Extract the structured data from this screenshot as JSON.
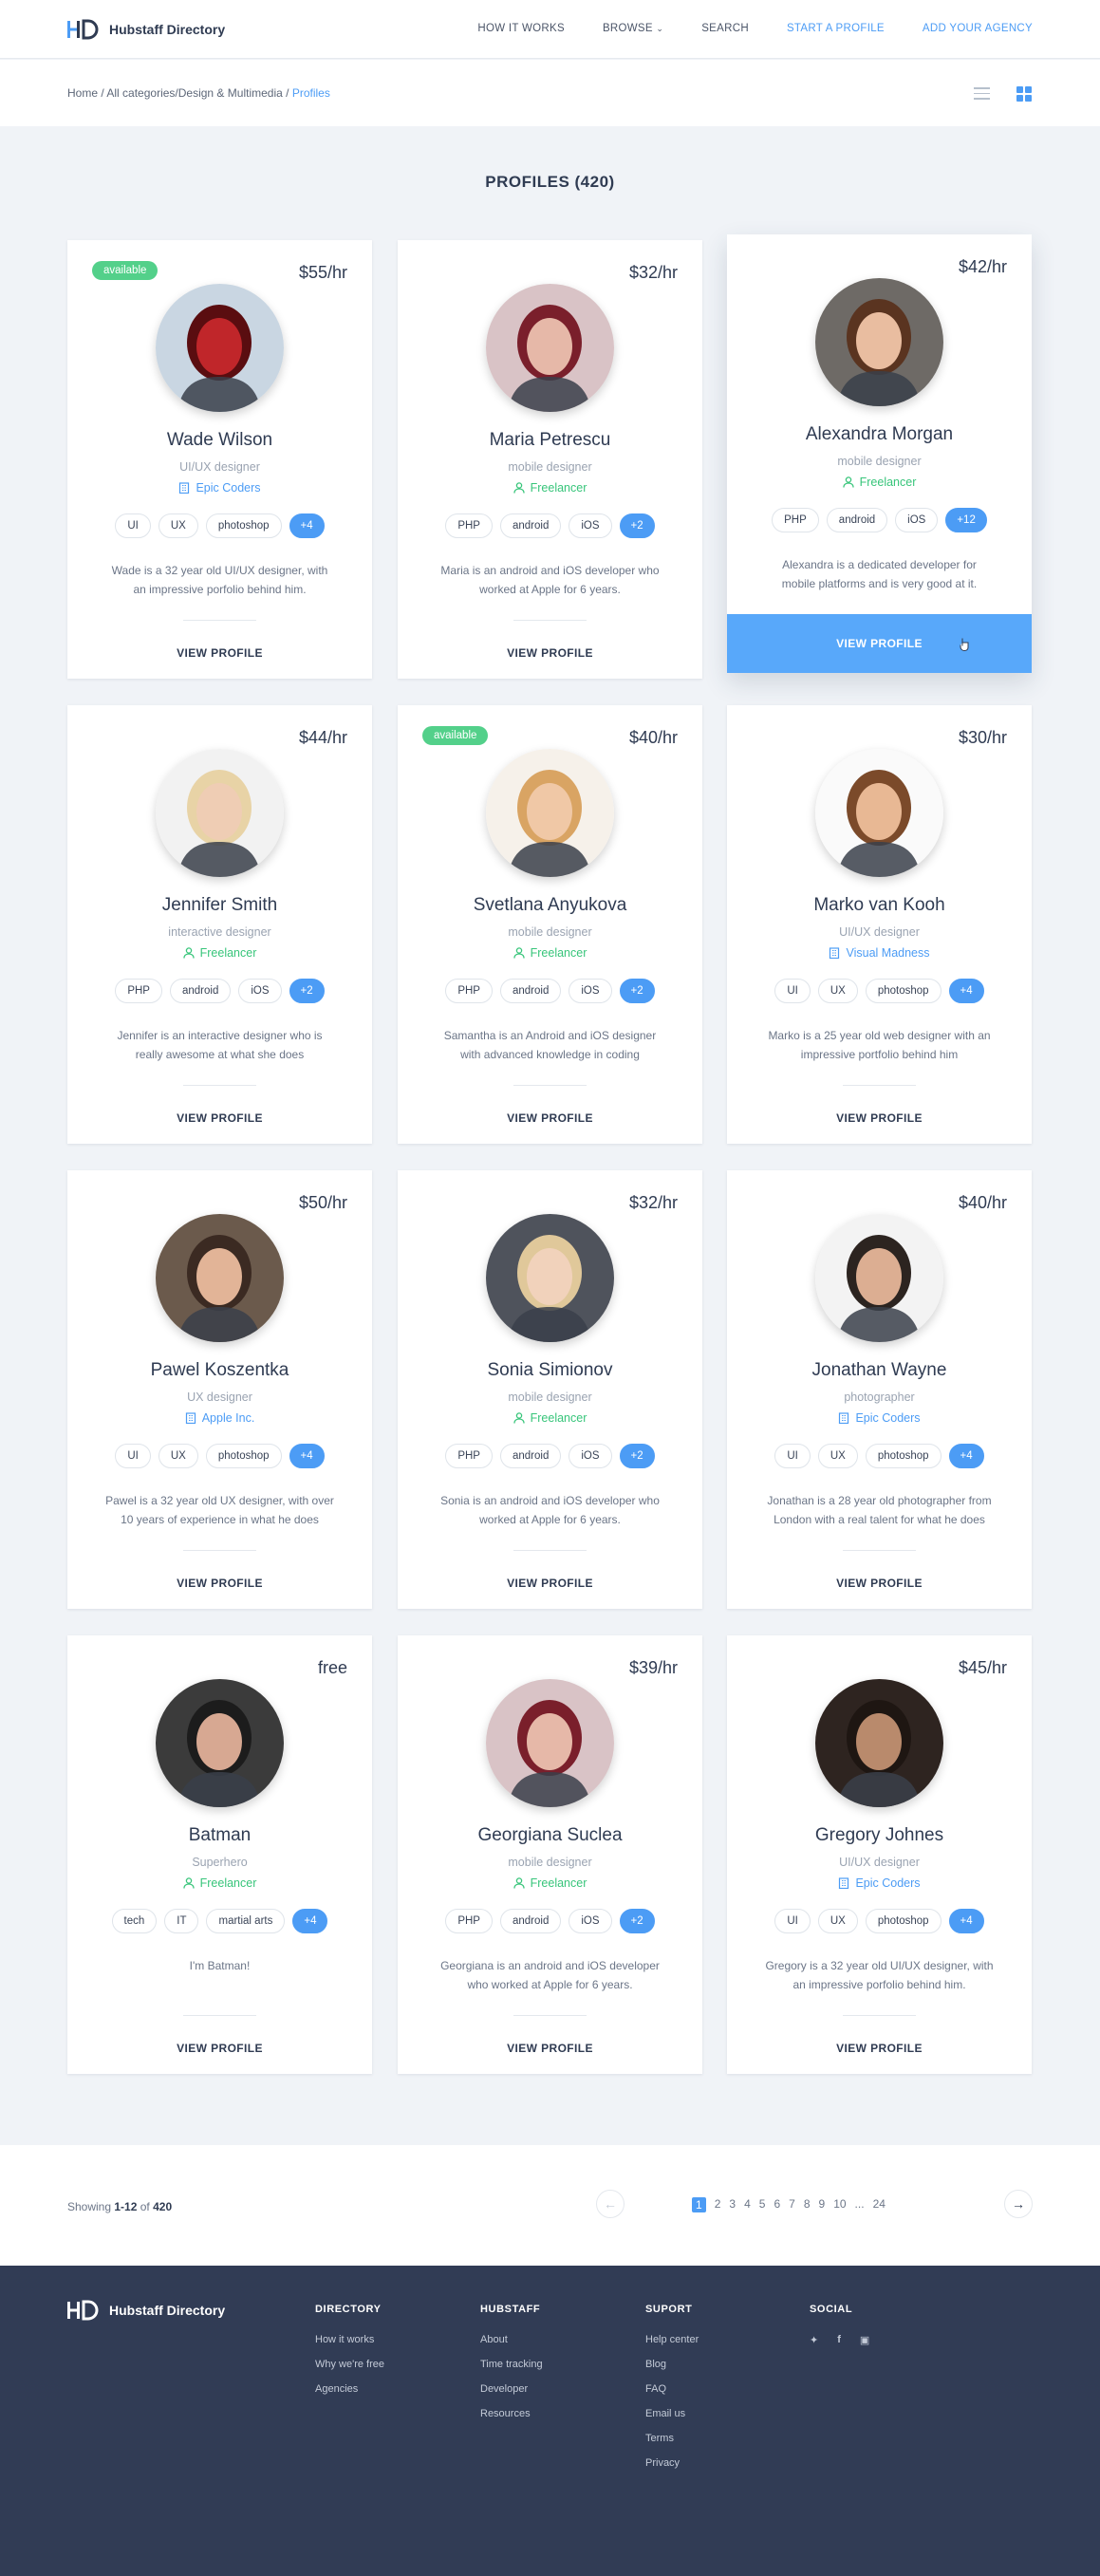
{
  "app": {
    "name": "Hubstaff Directory"
  },
  "nav": {
    "links": [
      "HOW IT WORKS",
      "BROWSE",
      "SEARCH"
    ],
    "cta": [
      "START A PROFILE",
      "ADD YOUR AGENCY"
    ]
  },
  "breadcrumb": {
    "home": "Home",
    "sep": "/",
    "middle": "All categories/Design & Multimedia",
    "current": "Profiles"
  },
  "page_title": "PROFILES (420)",
  "cards": [
    {
      "name": "Wade Wilson",
      "role": "UI/UX designer",
      "company": "Epic Coders",
      "company_type": "agency",
      "rate": "$55/hr",
      "badge": "available",
      "tags": [
        "UI",
        "UX",
        "photoshop"
      ],
      "more": "+4",
      "desc": "Wade is a 32 year old UI/UX designer, with an impressive porfolio behind him.",
      "action": "VIEW PROFILE"
    },
    {
      "name": "Maria Petrescu",
      "role": "mobile designer",
      "company": "Freelancer",
      "company_type": "freelancer",
      "rate": "$32/hr",
      "tags": [
        "PHP",
        "android",
        "iOS"
      ],
      "more": "+2",
      "desc": "Maria is an android and iOS developer who worked at Apple for 6 years.",
      "action": "VIEW PROFILE"
    },
    {
      "name": "Alexandra Morgan",
      "role": "mobile designer",
      "company": "Freelancer",
      "company_type": "freelancer",
      "rate": "$42/hr",
      "tags": [
        "PHP",
        "android",
        "iOS"
      ],
      "more": "+12",
      "desc": "Alexandra is a dedicated developer for mobile platforms and is very good at it.",
      "action": "VIEW PROFILE",
      "featured": true
    },
    {
      "name": "Jennifer Smith",
      "role": "interactive designer",
      "company": "Freelancer",
      "company_type": "freelancer",
      "rate": "$44/hr",
      "tags": [
        "PHP",
        "android",
        "iOS"
      ],
      "more": "+2",
      "desc": "Jennifer is an interactive designer who is really awesome at what she does",
      "action": "VIEW PROFILE"
    },
    {
      "name": "Svetlana Anyukova",
      "role": "mobile designer",
      "company": "Freelancer",
      "company_type": "freelancer",
      "rate": "$40/hr",
      "badge": "available",
      "tags": [
        "PHP",
        "android",
        "iOS"
      ],
      "more": "+2",
      "desc": "Samantha is an Android and iOS designer with advanced knowledge in coding",
      "action": "VIEW PROFILE"
    },
    {
      "name": "Marko van Kooh",
      "role": "UI/UX designer",
      "company": "Visual Madness",
      "company_type": "agency",
      "rate": "$30/hr",
      "tags": [
        "UI",
        "UX",
        "photoshop"
      ],
      "more": "+4",
      "desc": "Marko is a 25 year old  web designer with an impressive portfolio behind him",
      "action": "VIEW PROFILE"
    },
    {
      "name": "Pawel Koszentka",
      "role": "UX designer",
      "company": "Apple Inc.",
      "company_type": "agency",
      "rate": "$50/hr",
      "tags": [
        "UI",
        "UX",
        "photoshop"
      ],
      "more": "+4",
      "desc": "Pawel is a 32 year old UX designer, with over 10 years of experience in what he does",
      "action": "VIEW PROFILE"
    },
    {
      "name": "Sonia Simionov",
      "role": "mobile designer",
      "company": "Freelancer",
      "company_type": "freelancer",
      "rate": "$32/hr",
      "tags": [
        "PHP",
        "android",
        "iOS"
      ],
      "more": "+2",
      "desc": "Sonia is an android and iOS developer who worked at Apple for 6 years.",
      "action": "VIEW PROFILE"
    },
    {
      "name": "Jonathan Wayne",
      "role": "photographer",
      "company": "Epic Coders",
      "company_type": "agency",
      "rate": "$40/hr",
      "tags": [
        "UI",
        "UX",
        "photoshop"
      ],
      "more": "+4",
      "desc": "Jonathan is a 28 year old photographer from London with a real talent for what he does",
      "action": "VIEW PROFILE"
    },
    {
      "name": "Batman",
      "role": "Superhero",
      "company": "Freelancer",
      "company_type": "freelancer",
      "rate": "free",
      "tags": [
        "tech",
        "IT",
        "martial arts"
      ],
      "more": "+4",
      "desc": "I'm Batman!",
      "action": "VIEW PROFILE"
    },
    {
      "name": "Georgiana Suclea",
      "role": "mobile designer",
      "company": "Freelancer",
      "company_type": "freelancer",
      "rate": "$39/hr",
      "tags": [
        "PHP",
        "android",
        "iOS"
      ],
      "more": "+2",
      "desc": "Georgiana is an android and iOS developer who worked at Apple for 6 years.",
      "action": "VIEW PROFILE"
    },
    {
      "name": "Gregory Johnes",
      "role": "UI/UX designer",
      "company": "Epic Coders",
      "company_type": "agency",
      "rate": "$45/hr",
      "tags": [
        "UI",
        "UX",
        "photoshop"
      ],
      "more": "+4",
      "desc": "Gregory is a 32 year old UI/UX designer, with an impressive porfolio behind him.",
      "action": "VIEW PROFILE"
    }
  ],
  "avatars": [
    {
      "bg": "#c9d6e2",
      "skin": "#c0262a",
      "hair": "#5a0d10"
    },
    {
      "bg": "#d9c3c6",
      "skin": "#e6b8a8",
      "hair": "#7a1f2b"
    },
    {
      "bg": "#6e6a66",
      "skin": "#e9bda0",
      "hair": "#5a3420"
    },
    {
      "bg": "#f2f2f2",
      "skin": "#efcdb4",
      "hair": "#e8d3a6"
    },
    {
      "bg": "#f6f1ea",
      "skin": "#f0c8a6",
      "hair": "#d9a463"
    },
    {
      "bg": "#fafafa",
      "skin": "#e8b894",
      "hair": "#7b4a2a"
    },
    {
      "bg": "#6b5a4c",
      "skin": "#e2b497",
      "hair": "#3b2a22"
    },
    {
      "bg": "#4f535c",
      "skin": "#f1d2bb",
      "hair": "#e0c89a"
    },
    {
      "bg": "#f3f3f3",
      "skin": "#dcae92",
      "hair": "#2c2420"
    },
    {
      "bg": "#3b3b3b",
      "skin": "#d7a892",
      "hair": "#1c1c1c"
    },
    {
      "bg": "#d9c3c6",
      "skin": "#e6b8a8",
      "hair": "#7a1f2b"
    },
    {
      "bg": "#2e2420",
      "skin": "#b98a6c",
      "hair": "#1e1612"
    }
  ],
  "pagination": {
    "showing_label": "Showing",
    "range": "1-12",
    "of_label": "of",
    "total": "420",
    "pages": [
      "1",
      "2",
      "3",
      "4",
      "5",
      "6",
      "7",
      "8",
      "9",
      "10",
      "...",
      "24"
    ],
    "current": "1"
  },
  "footer": {
    "brand": "Hubstaff Directory",
    "columns": [
      {
        "title": "DIRECTORY",
        "items": [
          "How it works",
          "Why we're free",
          "Agencies"
        ]
      },
      {
        "title": "HUBSTAFF",
        "items": [
          "About",
          "Time tracking",
          "Developer",
          "Resources"
        ]
      },
      {
        "title": "SUPORT",
        "items": [
          "Help center",
          "Blog",
          "FAQ",
          "Email us",
          "Terms",
          "Privacy"
        ]
      }
    ],
    "social_title": "SOCIAL",
    "social": [
      "twitter-icon",
      "facebook-icon",
      "instagram-icon"
    ]
  },
  "colors": {
    "accent": "#4c9cf5",
    "available": "#53d08a",
    "freelancer": "#37c57a",
    "footer_bg": "#313c55",
    "page_bg": "#f0f3f7"
  }
}
